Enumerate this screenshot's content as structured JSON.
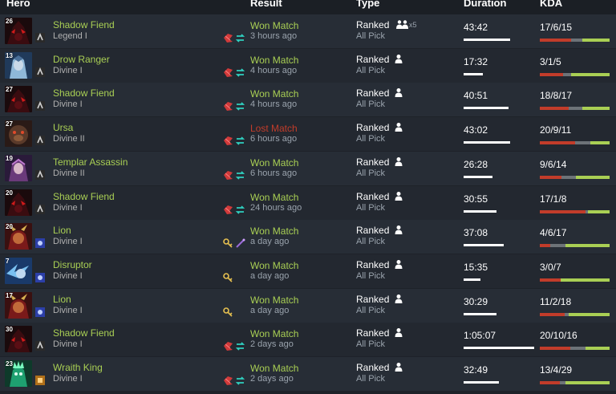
{
  "headers": {
    "hero": "Hero",
    "result": "Result",
    "type": "Type",
    "duration": "Duration",
    "kda": "KDA"
  },
  "colors": {
    "won": "#a9cf54",
    "lost": "#c23c2a",
    "kills_bar": "#c23c2a",
    "deaths_bar": "#6d7378",
    "assists_bar": "#a9cf54"
  },
  "matches": [
    {
      "hero": "Shadow Fiend",
      "level": "26",
      "rank": "Legend I",
      "result": "Won Match",
      "outcome": "won",
      "time_ago": "3 hours ago",
      "type": "Ranked",
      "party": "x5",
      "mode": "All Pick",
      "duration": "43:42",
      "duration_fraction": 0.66,
      "kda": "17/6/15",
      "k": 17,
      "d": 6,
      "a": 15,
      "items": [
        "aegis-icon",
        "swap-icon"
      ],
      "hero_art": "shadow-fiend",
      "attr": "agility"
    },
    {
      "hero": "Drow Ranger",
      "level": "13",
      "rank": "Divine I",
      "result": "Won Match",
      "outcome": "won",
      "time_ago": "4 hours ago",
      "type": "Ranked",
      "party": "",
      "mode": "All Pick",
      "duration": "17:32",
      "duration_fraction": 0.27,
      "kda": "3/1/5",
      "k": 3,
      "d": 1,
      "a": 5,
      "items": [
        "aegis-icon",
        "swap-icon"
      ],
      "hero_art": "drow",
      "attr": "agility"
    },
    {
      "hero": "Shadow Fiend",
      "level": "27",
      "rank": "Divine I",
      "result": "Won Match",
      "outcome": "won",
      "time_ago": "4 hours ago",
      "type": "Ranked",
      "party": "",
      "mode": "All Pick",
      "duration": "40:51",
      "duration_fraction": 0.64,
      "kda": "18/8/17",
      "k": 18,
      "d": 8,
      "a": 17,
      "items": [
        "aegis-icon",
        "swap-icon"
      ],
      "hero_art": "shadow-fiend",
      "attr": "agility"
    },
    {
      "hero": "Ursa",
      "level": "27",
      "rank": "Divine II",
      "result": "Lost Match",
      "outcome": "lost",
      "time_ago": "6 hours ago",
      "type": "Ranked",
      "party": "",
      "mode": "All Pick",
      "duration": "43:02",
      "duration_fraction": 0.66,
      "kda": "20/9/11",
      "k": 20,
      "d": 9,
      "a": 11,
      "items": [
        "aegis-icon",
        "swap-icon"
      ],
      "hero_art": "ursa",
      "attr": "agility"
    },
    {
      "hero": "Templar Assassin",
      "level": "19",
      "rank": "Divine II",
      "result": "Won Match",
      "outcome": "won",
      "time_ago": "6 hours ago",
      "type": "Ranked",
      "party": "",
      "mode": "All Pick",
      "duration": "26:28",
      "duration_fraction": 0.41,
      "kda": "9/6/14",
      "k": 9,
      "d": 6,
      "a": 14,
      "items": [
        "aegis-icon",
        "swap-icon"
      ],
      "hero_art": "templar",
      "attr": "agility"
    },
    {
      "hero": "Shadow Fiend",
      "level": "20",
      "rank": "Divine I",
      "result": "Won Match",
      "outcome": "won",
      "time_ago": "24 hours ago",
      "type": "Ranked",
      "party": "",
      "mode": "All Pick",
      "duration": "30:55",
      "duration_fraction": 0.47,
      "kda": "17/1/8",
      "k": 17,
      "d": 1,
      "a": 8,
      "items": [
        "aegis-icon",
        "swap-icon"
      ],
      "hero_art": "shadow-fiend",
      "attr": "agility"
    },
    {
      "hero": "Lion",
      "level": "20",
      "rank": "Divine I",
      "result": "Won Match",
      "outcome": "won",
      "time_ago": "a day ago",
      "type": "Ranked",
      "party": "",
      "mode": "All Pick",
      "duration": "37:08",
      "duration_fraction": 0.57,
      "kda": "4/6/17",
      "k": 4,
      "d": 6,
      "a": 17,
      "items": [
        "key-icon",
        "wand-icon"
      ],
      "hero_art": "lion",
      "attr": "intelligence"
    },
    {
      "hero": "Disruptor",
      "level": "7",
      "rank": "Divine I",
      "result": "Won Match",
      "outcome": "won",
      "time_ago": "a day ago",
      "type": "Ranked",
      "party": "",
      "mode": "All Pick",
      "duration": "15:35",
      "duration_fraction": 0.24,
      "kda": "3/0/7",
      "k": 3,
      "d": 0,
      "a": 7,
      "items": [
        "key-icon"
      ],
      "hero_art": "disruptor",
      "attr": "intelligence"
    },
    {
      "hero": "Lion",
      "level": "17",
      "rank": "Divine I",
      "result": "Won Match",
      "outcome": "won",
      "time_ago": "a day ago",
      "type": "Ranked",
      "party": "",
      "mode": "All Pick",
      "duration": "30:29",
      "duration_fraction": 0.47,
      "kda": "11/2/18",
      "k": 11,
      "d": 2,
      "a": 18,
      "items": [
        "key-icon"
      ],
      "hero_art": "lion",
      "attr": "intelligence"
    },
    {
      "hero": "Shadow Fiend",
      "level": "30",
      "rank": "Divine I",
      "result": "Won Match",
      "outcome": "won",
      "time_ago": "2 days ago",
      "type": "Ranked",
      "party": "",
      "mode": "All Pick",
      "duration": "1:05:07",
      "duration_fraction": 1.0,
      "kda": "20/10/16",
      "k": 20,
      "d": 10,
      "a": 16,
      "items": [
        "aegis-icon",
        "swap-icon"
      ],
      "hero_art": "shadow-fiend",
      "attr": "agility"
    },
    {
      "hero": "Wraith King",
      "level": "23",
      "rank": "Divine I",
      "result": "Won Match",
      "outcome": "won",
      "time_ago": "2 days ago",
      "type": "Ranked",
      "party": "",
      "mode": "All Pick",
      "duration": "32:49",
      "duration_fraction": 0.5,
      "kda": "13/4/29",
      "k": 13,
      "d": 4,
      "a": 29,
      "items": [
        "aegis-icon",
        "swap-icon"
      ],
      "hero_art": "wraith-king",
      "attr": "strength"
    }
  ]
}
